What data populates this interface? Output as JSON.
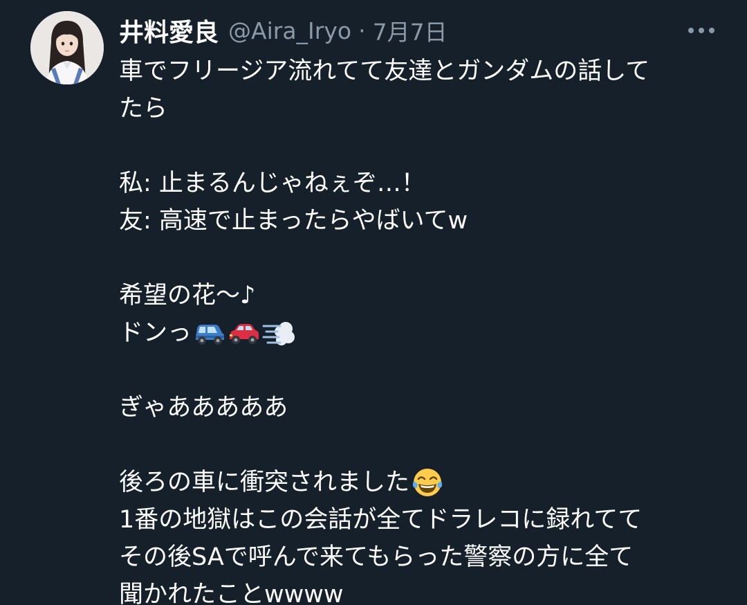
{
  "tweet": {
    "display_name": "井料愛良",
    "handle": "@Aira_Iryo",
    "separator": "·",
    "date": "7月7日",
    "more_icon": "more-horizontal-icon",
    "lines": [
      "車でフリージジア流れてて友達とガンダムの話してて",
      "たら"
    ]
  },
  "body": {
    "l1": "車でフリージア流れてて友達とガンダムの話して",
    "l2": "たら",
    "l3": "私: 止まるんじゃねぇぞ…！",
    "l4": "友: 高速で止まったらやばいてw",
    "l5": "希望の花〜♪",
    "l6": "ドンっ ",
    "l7": "ぎゃあああああ",
    "l8": "後ろの車に衝突されました",
    "l9": "1番の地獄はこの会話が全てドラレコに録れてて",
    "l10": "その後SAで呼んで来てもらった警察の方に全て",
    "l11": "聞かれたことwwww"
  },
  "emojis": {
    "car_blue": "blue-suv-emoji-icon",
    "car_red": "red-car-emoji-icon",
    "dash": "dash-emoji-icon",
    "laugh": "tears-of-joy-emoji-icon"
  },
  "colors": {
    "background": "#15202b",
    "text": "#ffffff",
    "secondary": "#8b98a5"
  }
}
